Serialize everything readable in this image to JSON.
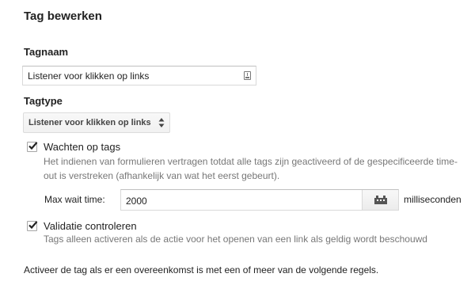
{
  "page": {
    "title": "Tag bewerken"
  },
  "tag_name": {
    "label": "Tagnaam",
    "value": "Listener voor klikken op links",
    "icon": "variable-icon"
  },
  "tag_type": {
    "label": "Tagtype",
    "selected": "Listener voor klikken op links",
    "icon": "select-arrows-icon"
  },
  "wait_for_tags": {
    "checked": true,
    "label": "Wachten op tags",
    "description": "Het indienen van formulieren vertragen totdat alle tags zijn geactiveerd of de gespecificeerde time-out is verstreken (afhankelijk van wat het eerst gebeurt).",
    "max_wait_label": "Max wait time:",
    "max_wait_value": "2000",
    "max_wait_unit": "milliseconden",
    "macro_icon": "macro-icon"
  },
  "validation": {
    "checked": true,
    "label": "Validatie controleren",
    "description": "Tags alleen activeren als de actie voor het openen van een link als geldig wordt beschouwd"
  },
  "rules": {
    "intro": "Activeer de tag als er een overeenkomst is met een of meer van de volgende regels."
  },
  "colors": {
    "text": "#222222",
    "muted_text": "#777777",
    "border": "#d9d9d9",
    "check": "#222222"
  }
}
